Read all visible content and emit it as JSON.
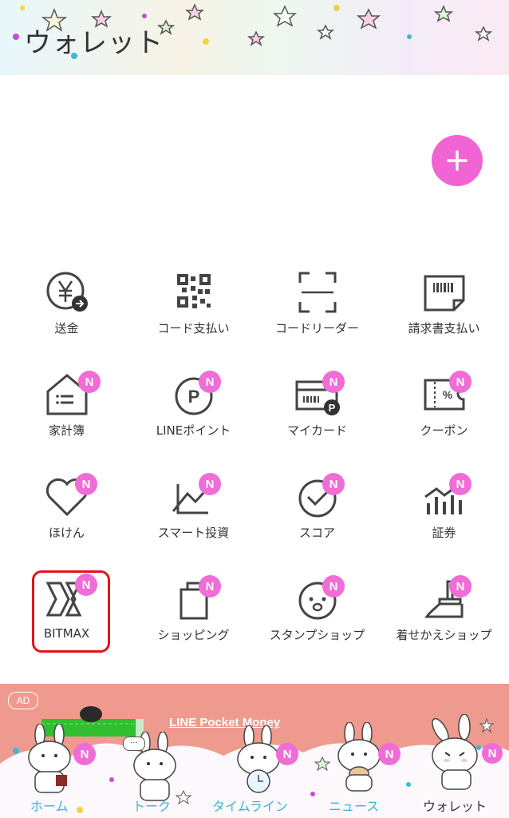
{
  "header": {
    "title": "ウォレット"
  },
  "fab": {
    "label": "+"
  },
  "grid": [
    {
      "label": "送金",
      "icon": "yen-transfer-icon",
      "badge": ""
    },
    {
      "label": "コード支払い",
      "icon": "qr-code-icon",
      "badge": ""
    },
    {
      "label": "コードリーダー",
      "icon": "scan-frame-icon",
      "badge": ""
    },
    {
      "label": "請求書支払い",
      "icon": "invoice-icon",
      "badge": ""
    },
    {
      "label": "家計簿",
      "icon": "household-book-icon",
      "badge": "N"
    },
    {
      "label": "LINEポイント",
      "icon": "points-icon",
      "badge": "N"
    },
    {
      "label": "マイカード",
      "icon": "card-icon",
      "badge": "N"
    },
    {
      "label": "クーポン",
      "icon": "coupon-icon",
      "badge": "N"
    },
    {
      "label": "ほけん",
      "icon": "heart-icon",
      "badge": "N"
    },
    {
      "label": "スマート投資",
      "icon": "chart-trend-icon",
      "badge": "N"
    },
    {
      "label": "スコア",
      "icon": "check-circle-icon",
      "badge": "N"
    },
    {
      "label": "証券",
      "icon": "bar-chart-icon",
      "badge": "N"
    },
    {
      "label": "BITMAX",
      "icon": "bitmax-logo-icon",
      "badge": "N"
    },
    {
      "label": "ショッピング",
      "icon": "shopping-bag-icon",
      "badge": "N"
    },
    {
      "label": "スタンプショップ",
      "icon": "sticker-face-icon",
      "badge": "N"
    },
    {
      "label": "着せかえショップ",
      "icon": "paint-brush-icon",
      "badge": "N"
    }
  ],
  "ad": {
    "tag": "AD",
    "text": "LINE Pocket Money"
  },
  "nav": [
    {
      "label": "ホーム",
      "badge": "N"
    },
    {
      "label": "トーク",
      "badge": ""
    },
    {
      "label": "タイムライン",
      "badge": "N"
    },
    {
      "label": "ニュース",
      "badge": "N"
    },
    {
      "label": "ウォレット",
      "badge": ""
    }
  ],
  "chat_bubble": "...",
  "colors": {
    "accent": "#f065d3",
    "badge": "#f06cd6",
    "highlight": "#e4141a",
    "nav_text": "#39b6d8",
    "banner": "#ee9a8e"
  }
}
